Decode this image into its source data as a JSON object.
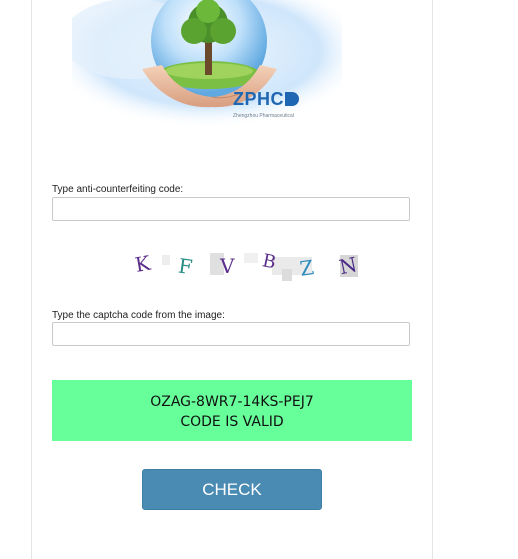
{
  "brand": {
    "name": "ZPHC",
    "tagline": "Zhengzhou Pharmaceutical"
  },
  "form": {
    "code_label": "Type anti-counterfeiting code:",
    "code_value": "",
    "captcha_label": "Type the captcha code from the image:",
    "captcha_value": "",
    "captcha_chars": [
      "K",
      "F",
      "V",
      "B",
      "Z",
      "N"
    ]
  },
  "result": {
    "code": "OZAG-8WR7-14KS-PEJ7",
    "status": "CODE IS VALID",
    "color": "#66ff99"
  },
  "actions": {
    "check_label": "CHECK",
    "button_color": "#4a8bb3"
  }
}
